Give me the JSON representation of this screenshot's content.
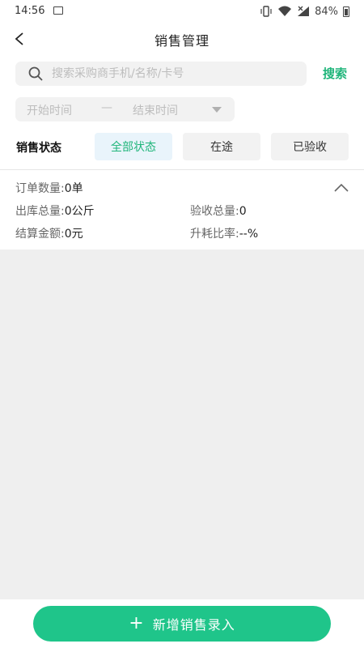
{
  "status_bar": {
    "time": "14:56",
    "battery": "84%"
  },
  "header": {
    "title": "销售管理"
  },
  "search": {
    "placeholder": "搜索采购商手机/名称/卡号",
    "value": "",
    "button_label": "搜索"
  },
  "date_range": {
    "start_placeholder": "开始时间",
    "separator": "—",
    "end_placeholder": "结束时间"
  },
  "status_filter": {
    "label": "销售状态",
    "options": [
      "全部状态",
      "在途",
      "已验收"
    ],
    "selected": "全部状态"
  },
  "stats": {
    "order_count_label": "订单数量:",
    "order_count_value": "0单",
    "outbound_total_label": "出库总量:",
    "outbound_total_value": "0公斤",
    "accepted_total_label": "验收总量:",
    "accepted_total_value": "0",
    "settlement_amount_label": "结算金额:",
    "settlement_amount_value": "0元",
    "loss_ratio_label": "升耗比率:",
    "loss_ratio_value": "--%"
  },
  "footer": {
    "add_button_icon": "+",
    "add_button_label": "新增销售录入"
  },
  "colors": {
    "accent": "#1fc58a",
    "accent_text": "#1fb57a",
    "chip_bg": "#f2f2f2",
    "chip_active_bg": "#e9f4fb",
    "page_bg": "#efefef"
  }
}
